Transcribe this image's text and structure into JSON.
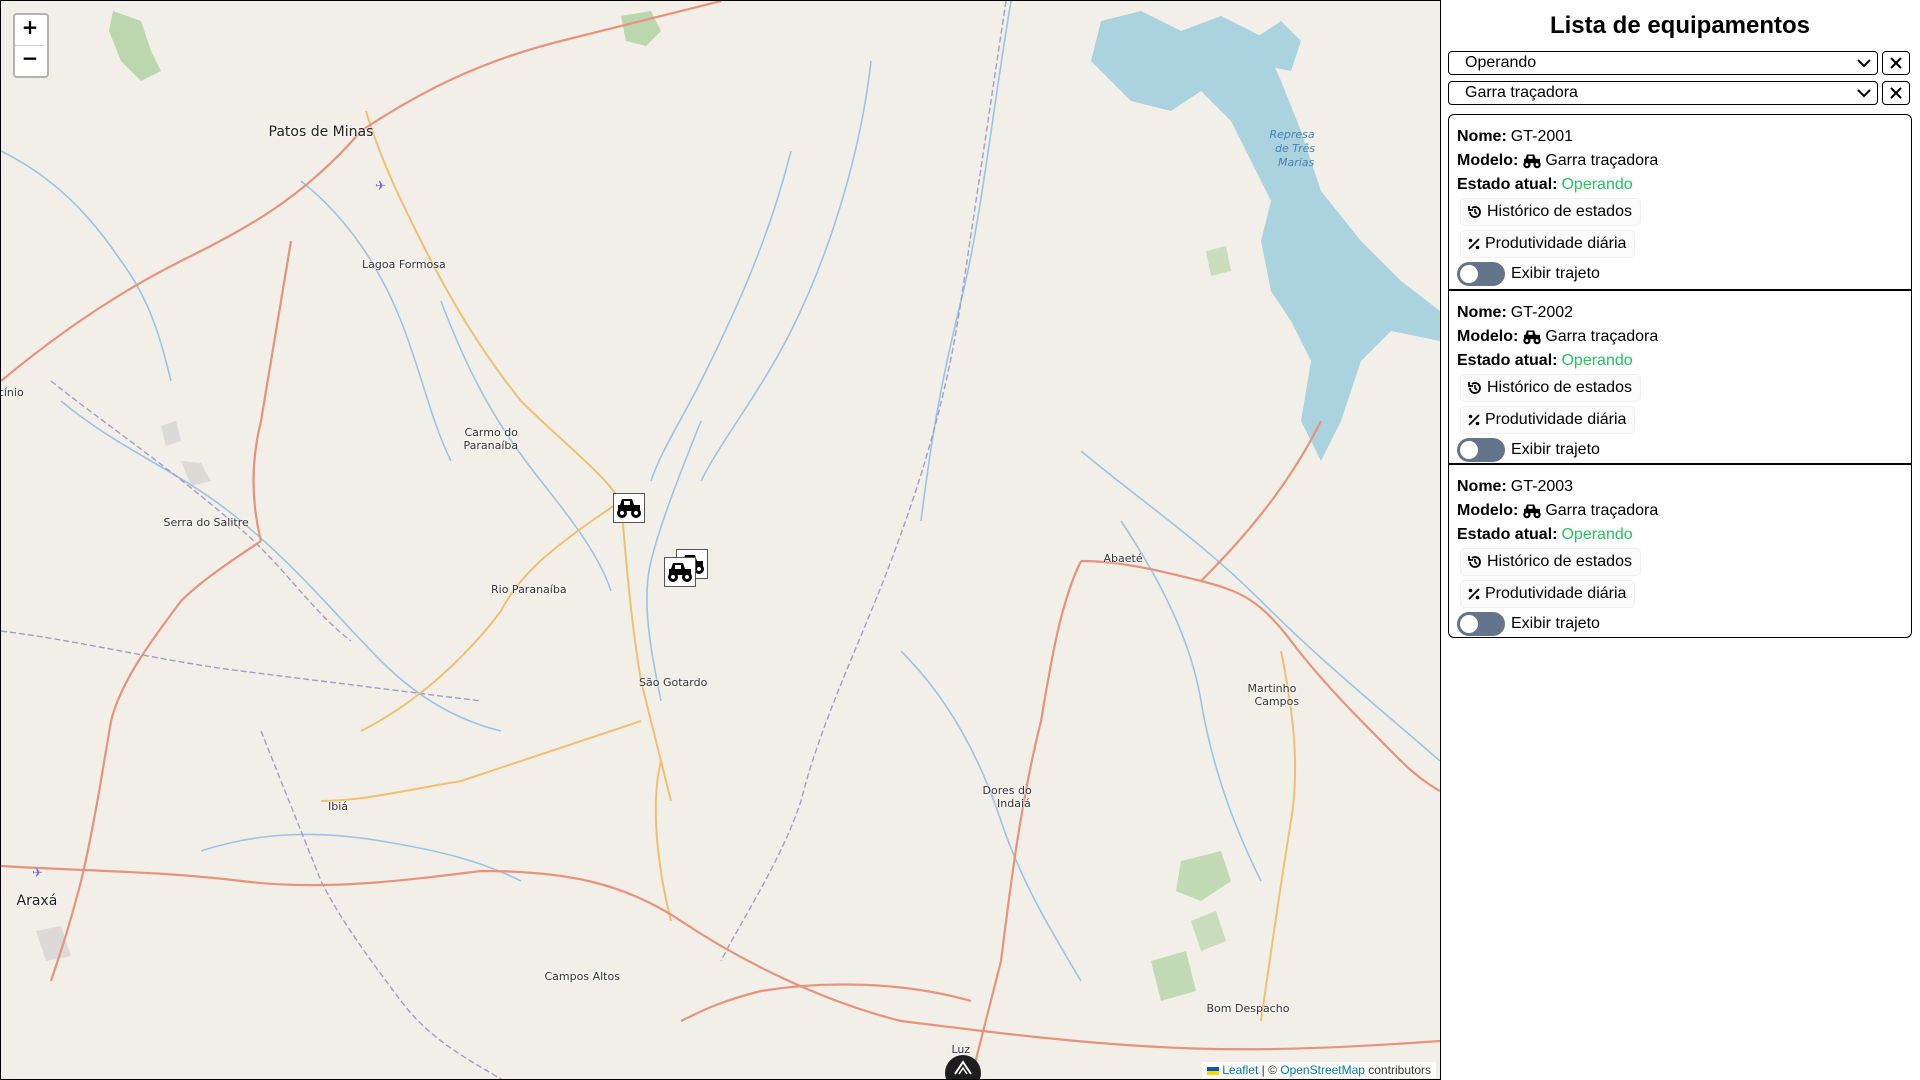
{
  "map": {
    "zoom_in_label": "+",
    "zoom_out_label": "−",
    "attribution": {
      "leaflet": "Leaflet",
      "separator": " | © ",
      "osm": "OpenStreetMap",
      "suffix": " contributors"
    },
    "places": {
      "patos_de_minas": "Patos de Minas",
      "lagoa_formosa": "Lagoa Formosa",
      "patrocinio": "trocínio",
      "carmo_do_paranaiba_1": "Carmo do",
      "carmo_do_paranaiba_2": "Paranaíba",
      "serra_do_salitre": "Serra do Salitre",
      "rio_paranaiba": "Rio Paranaíba",
      "sao_gotardo": "São Gotardo",
      "abaete": "Abaeté",
      "martinho_campos_1": "Martinho",
      "martinho_campos_2": "Campos",
      "dores_do_indaia_1": "Dores do",
      "dores_do_indaia_2": "Indaiá",
      "ibia": "Ibiá",
      "araxa": "Araxá",
      "campos_altos": "Campos Altos",
      "bom_despacho": "Bom Despacho",
      "luz": "Luz",
      "represa_1": "Represa",
      "represa_2": "de Três",
      "represa_3": "Marias"
    },
    "colors": {
      "land": "#f2efe9",
      "water": "#aad3df",
      "river": "#9cc3e4",
      "primary_road": "#e8927c",
      "secondary_road": "#f0c070",
      "border": "#9e9ec8",
      "forest": "#add19e"
    }
  },
  "sidebar": {
    "title": "Lista de equipamentos",
    "filters": [
      {
        "value": "Operando"
      },
      {
        "value": "Garra traçadora"
      }
    ],
    "labels": {
      "name": "Nome:",
      "model": "Modelo:",
      "state": "Estado atual:",
      "history": "Histórico de estados",
      "productivity": "Produtividade diária",
      "path": "Exibir trajeto"
    },
    "status_color": "#22c55e",
    "equipment": [
      {
        "name": "GT-2001",
        "model": "Garra traçadora",
        "state": "Operando"
      },
      {
        "name": "GT-2002",
        "model": "Garra traçadora",
        "state": "Operando"
      },
      {
        "name": "GT-2003",
        "model": "Garra traçadora",
        "state": "Operando"
      }
    ]
  }
}
